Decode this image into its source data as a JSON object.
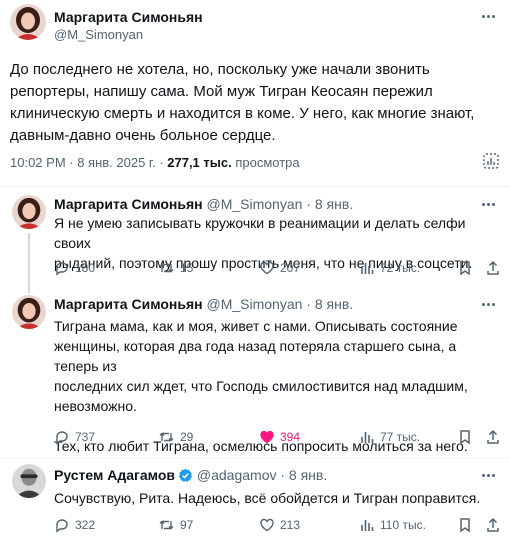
{
  "main_tweet": {
    "author_name": "Маргарита Симоньян",
    "author_handle": "@M_Simonyan",
    "text": "До последнего не хотела, но, поскольку уже начали звонить\nрепортеры, напишу сама. Мой муж Тигран Кеосаян пережил\nклиническую смерть и находится в коме. У него, как многие знают,\nдавным-давно очень больное сердце.",
    "time": "10:02 PM · 8 янв. 2025 г. · ",
    "views_count": "277,1 тыс.",
    "views_label": " просмотра"
  },
  "replies": [
    {
      "author_name": "Маргарита Симоньян",
      "author_handle": "@M_Simonyan",
      "date": " · 8 янв.",
      "text": "Я не умею записывать кружочки в реанимации и делать селфи своих\nрыданий, поэтому прошу простить меня, что не пишу в соцсети.",
      "replies": "180",
      "retweets": "15",
      "likes": "207",
      "views": "72 тыс.",
      "liked": false
    },
    {
      "author_name": "Маргарита Симоньян",
      "author_handle": "@M_Simonyan",
      "date": " · 8 янв.",
      "text": "Тиграна мама, как и моя, живет с нами. Описывать состояние\nженщины, которая два года назад потеряла старшего сына, а теперь из\nпоследних сил ждет, что Господь смилостивится над младшим,\nневозможно.\n\nТех, кто любит Тиграна, осмелюсь попросить молиться за него.",
      "replies": "737",
      "retweets": "29",
      "likes": "394",
      "views": "77 тыс.",
      "liked": true
    },
    {
      "author_name": "Рустем Адагамов",
      "author_handle": "@adagamov",
      "date": " · 8 янв.",
      "text": "Сочувствую, Рита. Надеюсь, всё обойдется и Тигран поправится.",
      "replies": "322",
      "retweets": "97",
      "likes": "213",
      "views": "110 тыс.",
      "liked": false,
      "verified": true
    }
  ],
  "colors": {
    "text": "#0f1419",
    "secondary": "#536471",
    "like_active": "#f91880",
    "verified_blue": "#1d9bf0"
  }
}
